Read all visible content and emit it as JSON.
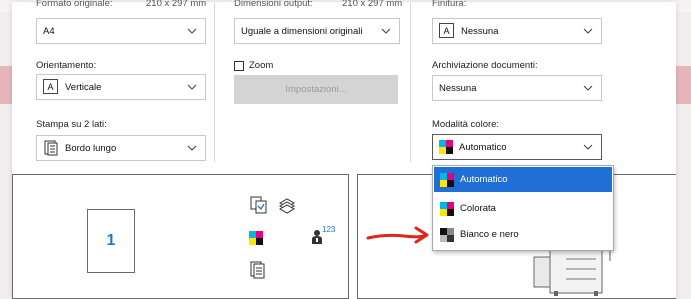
{
  "labels": {
    "formato_originale": "Formato originale:",
    "formato_originale_size": "210 x 297 mm",
    "dimensioni_output": "Dimensioni output:",
    "dimensioni_output_size": "210 x 297 mm",
    "finitura": "Finitura:",
    "orientamento": "Orientamento:",
    "zoom": "Zoom",
    "archiviazione": "Archiviazione documenti:",
    "stampa_2_lati": "Stampa su 2 lati:",
    "modalita_colore": "Modalità colore:"
  },
  "fields": {
    "formato_originale_value": "A4",
    "dimensioni_output_value": "Uguale a dimensioni originali",
    "finitura_value": "Nessuna",
    "orientamento_value": "Verticale",
    "impostazioni_button": "Impostazioni...",
    "archiviazione_value": "Nessuna",
    "stampa_2_lati_value": "Bordo lungo",
    "modalita_colore_value": "Automatico"
  },
  "color_dropdown": {
    "options": [
      "Automatico",
      "Colorata",
      "Bianco e nero"
    ],
    "highlighted": "Automatico"
  },
  "preview": {
    "page_number": "1",
    "copies_superscript": "123"
  },
  "colors": {
    "highlight": "#1f6fd6",
    "annotation_arrow": "#e0261c",
    "page_number": "#1f78c8"
  }
}
